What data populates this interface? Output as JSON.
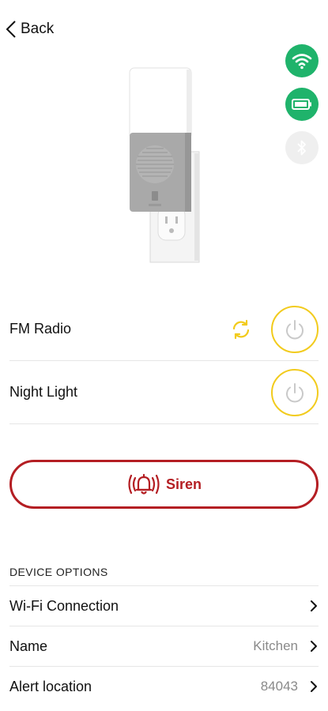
{
  "nav": {
    "back_label": "Back"
  },
  "status": [
    {
      "icon": "wifi-icon",
      "color": "#1fb36b"
    },
    {
      "icon": "battery-icon",
      "color": "#1fb36b"
    },
    {
      "icon": "bluetooth-icon",
      "color": "#ececec"
    }
  ],
  "controls": {
    "fm_radio_label": "FM Radio",
    "night_light_label": "Night Light",
    "siren_label": "Siren"
  },
  "device_options": {
    "title": "DEVICE OPTIONS",
    "items": [
      {
        "label": "Wi-Fi Connection",
        "value": ""
      },
      {
        "label": "Name",
        "value": "Kitchen"
      },
      {
        "label": "Alert location",
        "value": "84043"
      }
    ]
  },
  "colors": {
    "accent_yellow": "#f2cb1d",
    "siren_red": "#b41e23",
    "status_green": "#1fb36b"
  }
}
